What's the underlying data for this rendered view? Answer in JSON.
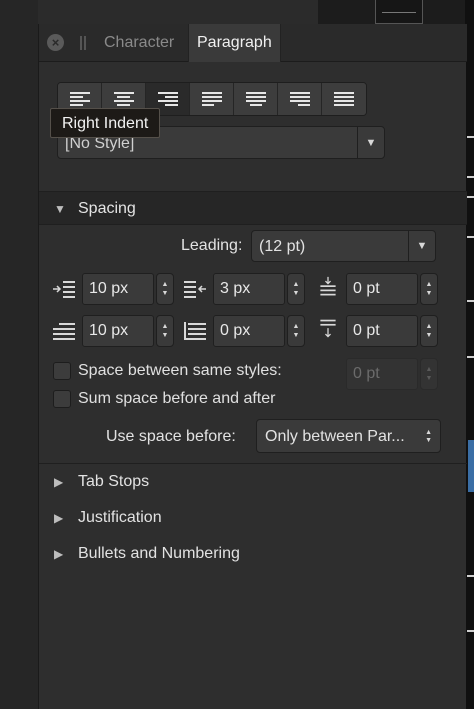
{
  "tabs": {
    "character": "Character",
    "paragraph": "Paragraph"
  },
  "close_symbol": "×",
  "alignment": {
    "buttons": [
      {
        "name": "align-left-button",
        "kind": "left",
        "active": false
      },
      {
        "name": "align-center-button",
        "kind": "center",
        "active": false
      },
      {
        "name": "align-right-button",
        "kind": "right",
        "active": true
      },
      {
        "name": "justify-left-button",
        "kind": "justify-left",
        "active": false
      },
      {
        "name": "justify-center-button",
        "kind": "justify-center",
        "active": false
      },
      {
        "name": "justify-right-button",
        "kind": "justify-right",
        "active": false
      },
      {
        "name": "justify-all-button",
        "kind": "justify-all",
        "active": false
      }
    ]
  },
  "tooltip": "Right Indent",
  "paragraph_style": {
    "value": "[No Style]"
  },
  "sections": {
    "spacing": "Spacing",
    "tab_stops": "Tab Stops",
    "justification": "Justification",
    "bullets": "Bullets and Numbering"
  },
  "spacing": {
    "leading_label": "Leading:",
    "leading_value": "(12 pt)",
    "left_indent": "10 px",
    "right_indent": "3 px",
    "space_before": "0 pt",
    "first_line_indent": "10 px",
    "last_line_indent": "0 px",
    "space_after": "0 pt",
    "same_styles_label": "Space between same styles:",
    "same_styles_value": "0 pt",
    "sum_space_label": "Sum space before and after",
    "use_space_before_label": "Use space before:",
    "use_space_before_value": "Only between Par..."
  },
  "colors": {
    "panel": "#2e2e2e",
    "accent_blue": "#3a6ea5",
    "tooltip_bg": "#1d1a17"
  }
}
